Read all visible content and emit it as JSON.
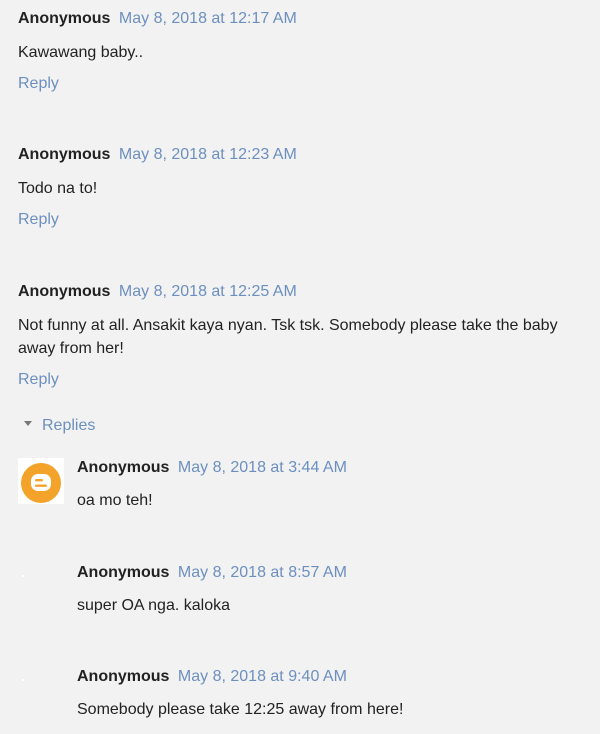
{
  "comments": [
    {
      "author": "Anonymous",
      "timestamp": "May 8, 2018 at 12:17 AM",
      "body": "Kawawang baby..",
      "reply_label": "Reply"
    },
    {
      "author": "Anonymous",
      "timestamp": "May 8, 2018 at 12:23 AM",
      "body": "Todo na to!",
      "reply_label": "Reply"
    },
    {
      "author": "Anonymous",
      "timestamp": "May 8, 2018 at 12:25 AM",
      "body": "Not funny at all. Ansakit kaya nyan. Tsk tsk. Somebody please take the baby away from her!",
      "reply_label": "Reply"
    }
  ],
  "replies_toggle": {
    "label": "Replies",
    "icon": "caret-down-icon"
  },
  "replies": [
    {
      "author": "Anonymous",
      "timestamp": "May 8, 2018 at 3:44 AM",
      "body": "oa mo teh!",
      "avatar": "blogger-logo-icon"
    },
    {
      "author": "Anonymous",
      "timestamp": "May 8, 2018 at 8:57 AM",
      "body": "super OA nga. kaloka",
      "avatar": "blank-avatar"
    },
    {
      "author": "Anonymous",
      "timestamp": "May 8, 2018 at 9:40 AM",
      "body": "Somebody please take 12:25 away from here!",
      "avatar": "blank-avatar"
    }
  ],
  "colors": {
    "background": "#f2f2f2",
    "link": "#6c8fbf",
    "text": "#222222",
    "blogger_orange": "#f4a32a"
  }
}
